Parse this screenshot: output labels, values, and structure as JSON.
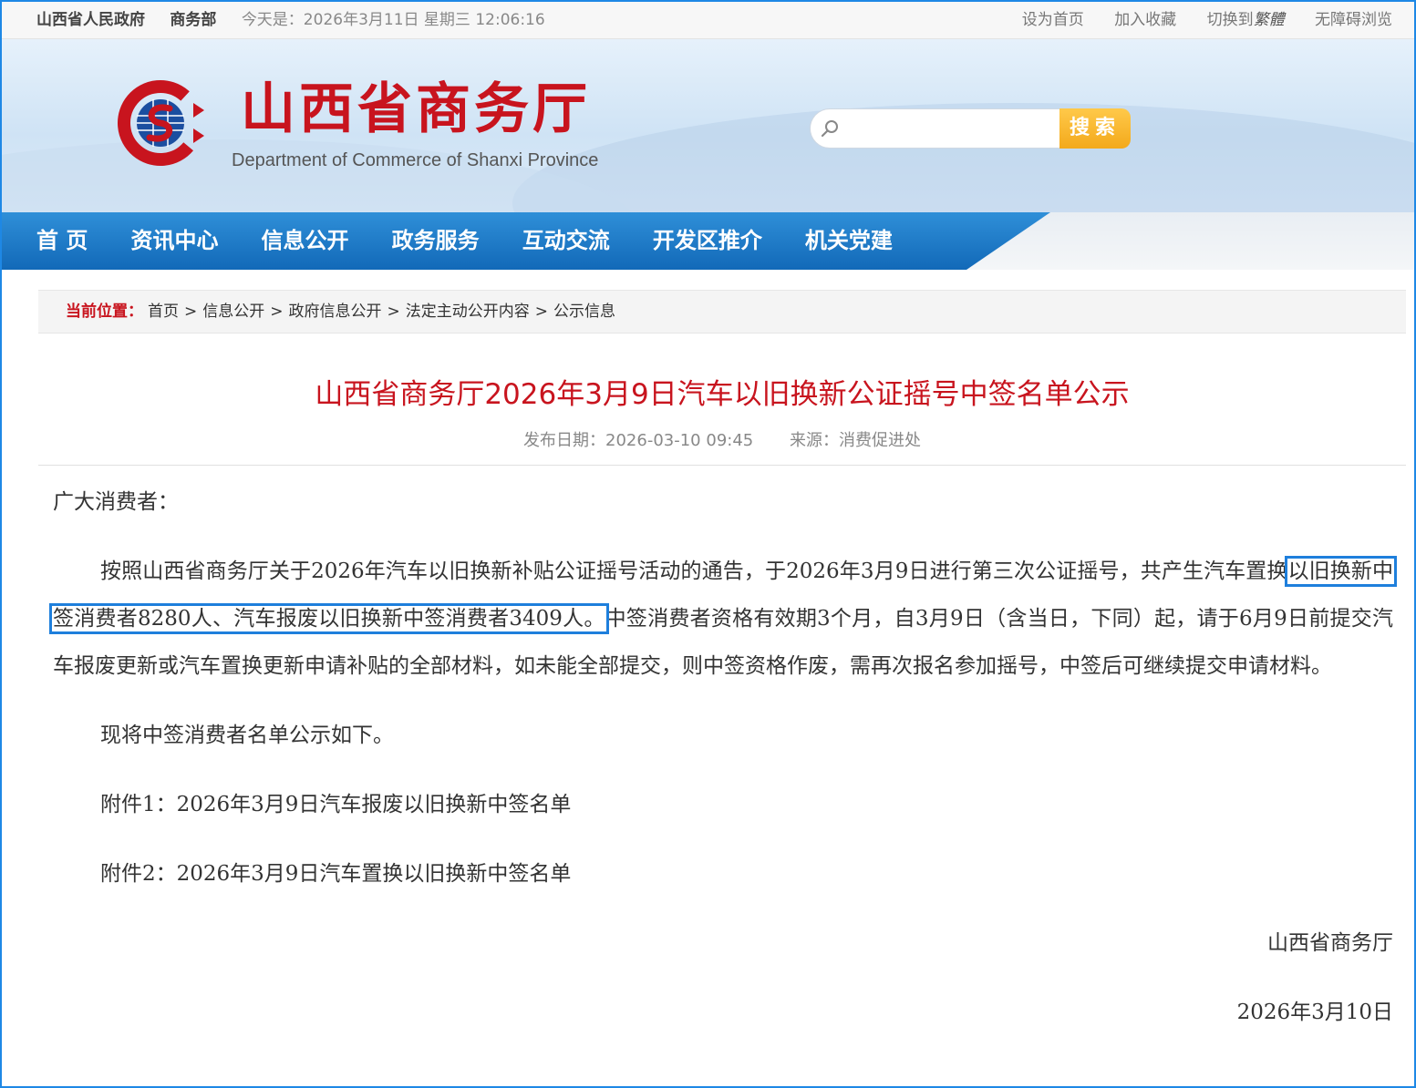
{
  "topbar": {
    "links_left": [
      "山西省人民政府",
      "商务部"
    ],
    "date_text": "今天是：2026年3月11日 星期三   12:06:16",
    "links_right": [
      "设为首页",
      "加入收藏"
    ],
    "switch_prefix": "切换到",
    "switch_target": "繁體",
    "accessibility": "无障碍浏览"
  },
  "header": {
    "site_title": "山西省商务厅",
    "site_subtitle": "Department of Commerce of Shanxi Province",
    "search_placeholder": "",
    "search_button": "搜索"
  },
  "nav": {
    "items": [
      "首 页",
      "资讯中心",
      "信息公开",
      "政务服务",
      "互动交流",
      "开发区推介",
      "机关党建"
    ]
  },
  "breadcrumb": {
    "label": "当前位置：",
    "items": [
      "首页",
      "信息公开",
      "政府信息公开",
      "法定主动公开内容",
      "公示信息"
    ],
    "separator": ">"
  },
  "article": {
    "title": "山西省商务厅2026年3月9日汽车以旧换新公证摇号中签名单公示",
    "publish_label": "发布日期：",
    "publish_date": "2026-03-10 09:45",
    "source_label": "来源：",
    "source": "消费促进处",
    "greeting": "广大消费者：",
    "p1_before": "按照山西省商务厅关于2026年汽车以旧换新补贴公证摇号活动的通告，于2026年3月9日进行第三次公证摇号，共产生汽车置换",
    "p1_highlight": "以旧换新中签消费者8280人、汽车报废以旧换新中签消费者3409人。",
    "p1_after": "中签消费者资格有效期3个月，自3月9日（含当日，下同）起，请于6月9日前提交汽车报废更新或汽车置换更新申请补贴的全部材料，如未能全部提交，则中签资格作废，需再次报名参加摇号，中签后可继续提交申请材料。",
    "p2": "现将中签消费者名单公示如下。",
    "attachment1": "附件1：2026年3月9日汽车报废以旧换新中签名单",
    "attachment2": "附件2：2026年3月9日汽车置换以旧换新中签名单",
    "signature": "山西省商务厅",
    "sign_date": "2026年3月10日"
  },
  "colors": {
    "brand_red": "#c8141e",
    "nav_blue": "#1269b8",
    "search_orange": "#f3a91b",
    "highlight_blue": "#1e7fdc"
  }
}
